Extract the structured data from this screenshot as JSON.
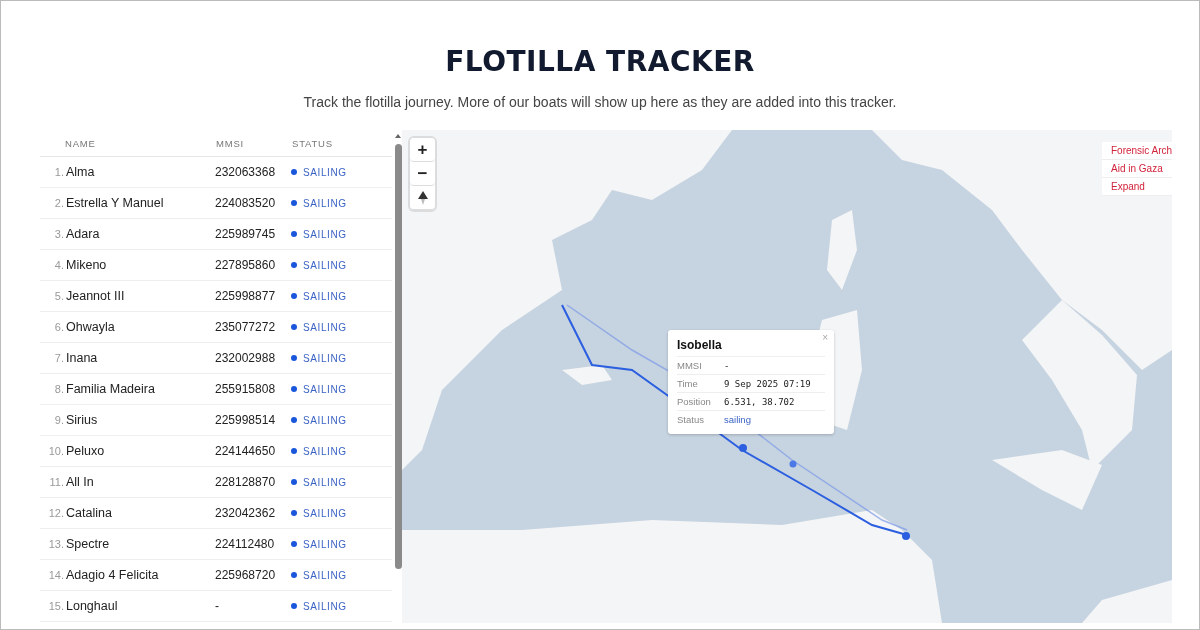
{
  "header": {
    "title": "FLOTILLA TRACKER",
    "subtitle": "Track the flotilla journey. More of our boats will show up here as they are added into this tracker."
  },
  "table": {
    "columns": [
      "NAME",
      "MMSI",
      "STATUS"
    ],
    "rows": [
      {
        "index": "1.",
        "name": "Alma",
        "mmsi": "232063368",
        "status": "SAILING",
        "color": "#1a56db"
      },
      {
        "index": "2.",
        "name": "Estrella Y Manuel",
        "mmsi": "224083520",
        "status": "SAILING",
        "color": "#1a56db"
      },
      {
        "index": "3.",
        "name": "Adara",
        "mmsi": "225989745",
        "status": "SAILING",
        "color": "#1a56db"
      },
      {
        "index": "4.",
        "name": "Mikeno",
        "mmsi": "227895860",
        "status": "SAILING",
        "color": "#1a56db"
      },
      {
        "index": "5.",
        "name": "Jeannot III",
        "mmsi": "225998877",
        "status": "SAILING",
        "color": "#1a56db"
      },
      {
        "index": "6.",
        "name": "Ohwayla",
        "mmsi": "235077272",
        "status": "SAILING",
        "color": "#1a56db"
      },
      {
        "index": "7.",
        "name": "Inana",
        "mmsi": "232002988",
        "status": "SAILING",
        "color": "#1a56db"
      },
      {
        "index": "8.",
        "name": "Familia Madeira",
        "mmsi": "255915808",
        "status": "SAILING",
        "color": "#1a56db"
      },
      {
        "index": "9.",
        "name": "Sirius",
        "mmsi": "225998514",
        "status": "SAILING",
        "color": "#1a56db"
      },
      {
        "index": "10.",
        "name": "Peluxo",
        "mmsi": "224144650",
        "status": "SAILING",
        "color": "#1a56db"
      },
      {
        "index": "11.",
        "name": "All In",
        "mmsi": "228128870",
        "status": "SAILING",
        "color": "#1a56db"
      },
      {
        "index": "12.",
        "name": "Catalina",
        "mmsi": "232042362",
        "status": "SAILING",
        "color": "#1a56db"
      },
      {
        "index": "13.",
        "name": "Spectre",
        "mmsi": "224112480",
        "status": "SAILING",
        "color": "#1a56db"
      },
      {
        "index": "14.",
        "name": "Adagio 4 Felicita",
        "mmsi": "225968720",
        "status": "SAILING",
        "color": "#1a56db"
      },
      {
        "index": "15.",
        "name": "Longhaul",
        "mmsi": "-",
        "status": "SAILING",
        "color": "#1a56db"
      }
    ]
  },
  "map": {
    "kind": "picture",
    "zoom_controls": [
      "+",
      "−"
    ],
    "popup": {
      "title": "Isobella",
      "close": "×",
      "fields": [
        {
          "label": "MMSI",
          "value": "-",
          "kind": "text"
        },
        {
          "label": "Time",
          "value": "9 Sep 2025 07:19",
          "kind": "text"
        },
        {
          "label": "Position",
          "value": "6.531, 38.702",
          "kind": "text"
        },
        {
          "label": "Status",
          "value": "sailing",
          "kind": "status"
        }
      ]
    },
    "layers": [
      "Forensic Arch",
      "Aid in Gaza",
      "Expand"
    ]
  }
}
